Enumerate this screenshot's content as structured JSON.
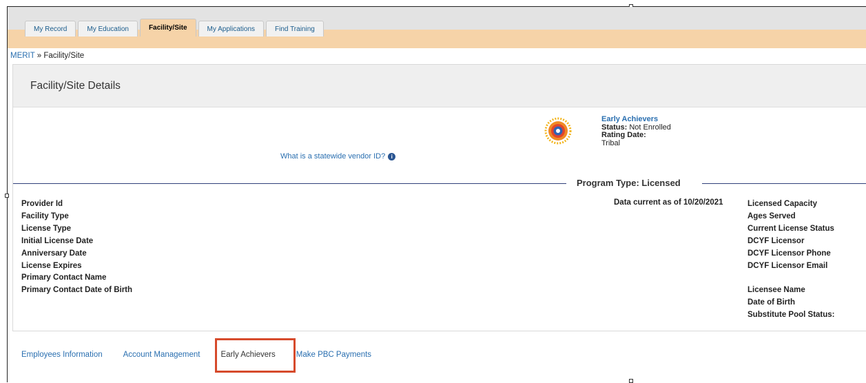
{
  "tabs": [
    {
      "label": "My Record"
    },
    {
      "label": "My Education"
    },
    {
      "label": "Facility/Site"
    },
    {
      "label": "My Applications"
    },
    {
      "label": "Find Training"
    }
  ],
  "breadcrumb": {
    "root": "MERIT",
    "separator": " » ",
    "current": "Facility/Site"
  },
  "panel": {
    "title": "Facility/Site Details"
  },
  "vendor": {
    "link": "What is a statewide vendor ID?",
    "icon": "info-icon"
  },
  "early_achievers": {
    "title": "Early Achievers",
    "status_label": "Status:",
    "status_value": " Not Enrolled",
    "rating_label": "Rating Date:",
    "tribal": "Tribal"
  },
  "program_type": "Program Type: Licensed",
  "left_fields": [
    "Provider Id",
    "Facility Type",
    "License Type",
    "Initial License Date",
    "Anniversary Date",
    "License Expires",
    "Primary Contact Name",
    "Primary Contact Date of Birth"
  ],
  "data_current": "Data current as of 10/20/2021",
  "right_fields": [
    "Licensed Capacity",
    "Ages Served",
    "Current License Status",
    "DCYF Licensor",
    "DCYF Licensor Phone",
    "DCYF Licensor Email"
  ],
  "right_fields_2": [
    "Licensee Name",
    "Date of Birth",
    "Substitute Pool Status:"
  ],
  "bottom_links": [
    "Employees Information",
    "Account Management",
    "Early Achievers",
    "Make PBC Payments"
  ],
  "colors": {
    "accent_link": "#2a6fb0",
    "tab_active": "#f6d3a8",
    "highlight": "#d64a2b"
  }
}
